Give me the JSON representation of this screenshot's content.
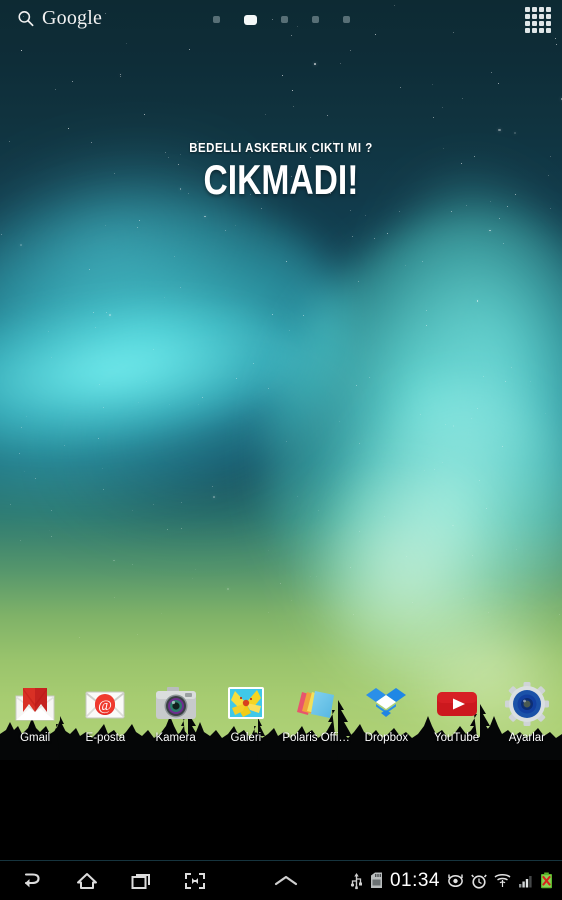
{
  "statusbar": {
    "google_widget": {
      "label": "Google",
      "icon": "search-icon"
    },
    "apps_button_icon": "app-drawer-grid-icon",
    "page_indicator": {
      "total": 5,
      "active_index": 1
    }
  },
  "widget": {
    "line1": "BEDELLI ASKERLIK CIKTI MI ?",
    "line2": "CIKMADI!"
  },
  "dock": {
    "apps": [
      {
        "label": "Gmail",
        "icon": "gmail-icon"
      },
      {
        "label": "E-posta",
        "icon": "email-icon"
      },
      {
        "label": "Kamera",
        "icon": "camera-icon"
      },
      {
        "label": "Galeri",
        "icon": "gallery-icon"
      },
      {
        "label": "Polaris Offi…",
        "icon": "polaris-office-icon"
      },
      {
        "label": "Dropbox",
        "icon": "dropbox-icon"
      },
      {
        "label": "YouTube",
        "icon": "youtube-icon"
      },
      {
        "label": "Ayarlar",
        "icon": "settings-gear-icon"
      }
    ]
  },
  "navbar": {
    "back_icon": "back-arrow-icon",
    "home_icon": "home-icon",
    "recents_icon": "recent-apps-icon",
    "screenshot_icon": "screenshot-capture-icon",
    "expand_icon": "chevron-up-icon",
    "clock": "01:34",
    "status_icons": [
      "usb-icon",
      "sd-card-icon",
      "eye-icon",
      "alarm-clock-icon",
      "wifi-icon",
      "cellular-signal-icon",
      "battery-error-icon"
    ]
  },
  "colors": {
    "sky_top": "#0d2a33",
    "sky_bottom": "#b2d479",
    "aurora_cyan": "#46e1e1",
    "aurora_green": "#9afab8",
    "accent_white": "#ffffff",
    "navbar_bg": "#000000",
    "gmail_red": "#d93025",
    "dropbox_blue": "#2a8fe8",
    "youtube_red": "#cc181e",
    "settings_blue": "#1b52a8"
  }
}
